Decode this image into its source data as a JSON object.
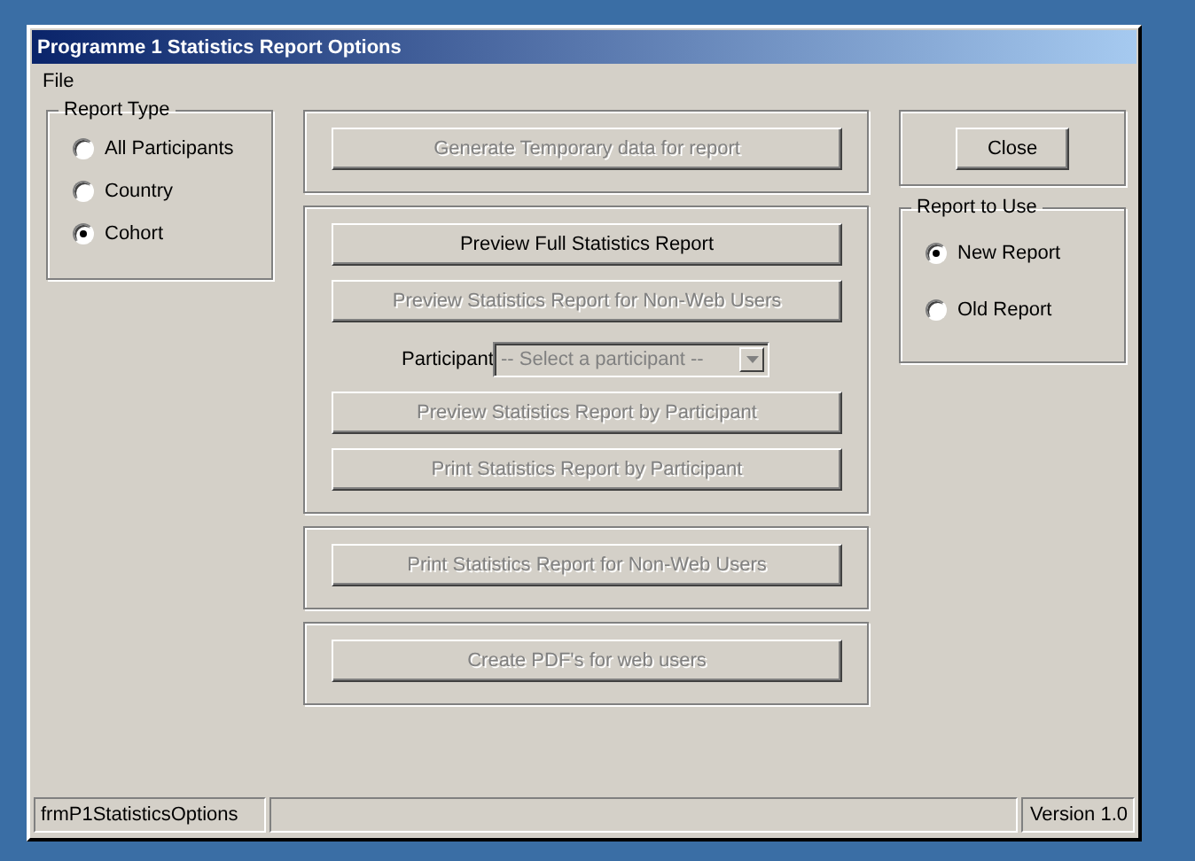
{
  "window": {
    "title": "Programme 1 Statistics Report Options"
  },
  "menu": [
    {
      "label": "File"
    }
  ],
  "report_type": {
    "title": "Report Type",
    "options": [
      {
        "label": "All Participants",
        "selected": false
      },
      {
        "label": "Country",
        "selected": false
      },
      {
        "label": "Cohort",
        "selected": true
      }
    ]
  },
  "panels": [
    {
      "items": [
        {
          "kind": "button",
          "label": "Generate Temporary data for report",
          "disabled": true
        }
      ]
    },
    {
      "items": [
        {
          "kind": "button",
          "label": "Preview Full Statistics Report",
          "disabled": false
        },
        {
          "kind": "button",
          "label": "Preview Statistics Report for Non-Web Users",
          "disabled": true
        },
        {
          "kind": "select",
          "label": "Participant",
          "placeholder": "-- Select a participant --",
          "disabled": true
        },
        {
          "kind": "button",
          "label": "Preview Statistics Report by Participant",
          "disabled": true
        },
        {
          "kind": "button",
          "label": "Print Statistics Report by Participant",
          "disabled": true
        }
      ]
    },
    {
      "items": [
        {
          "kind": "button",
          "label": "Print Statistics Report for Non-Web Users",
          "disabled": true
        }
      ]
    },
    {
      "items": [
        {
          "kind": "button",
          "label": "Create PDF's for web users",
          "disabled": true
        }
      ]
    }
  ],
  "close_button": {
    "label": "Close",
    "disabled": false
  },
  "report_to_use": {
    "title": "Report to Use",
    "options": [
      {
        "label": "New Report",
        "selected": true
      },
      {
        "label": "Old Report",
        "selected": false
      }
    ]
  },
  "status_bar": {
    "form_name": "frmP1StatisticsOptions",
    "version": "Version 1.0"
  }
}
